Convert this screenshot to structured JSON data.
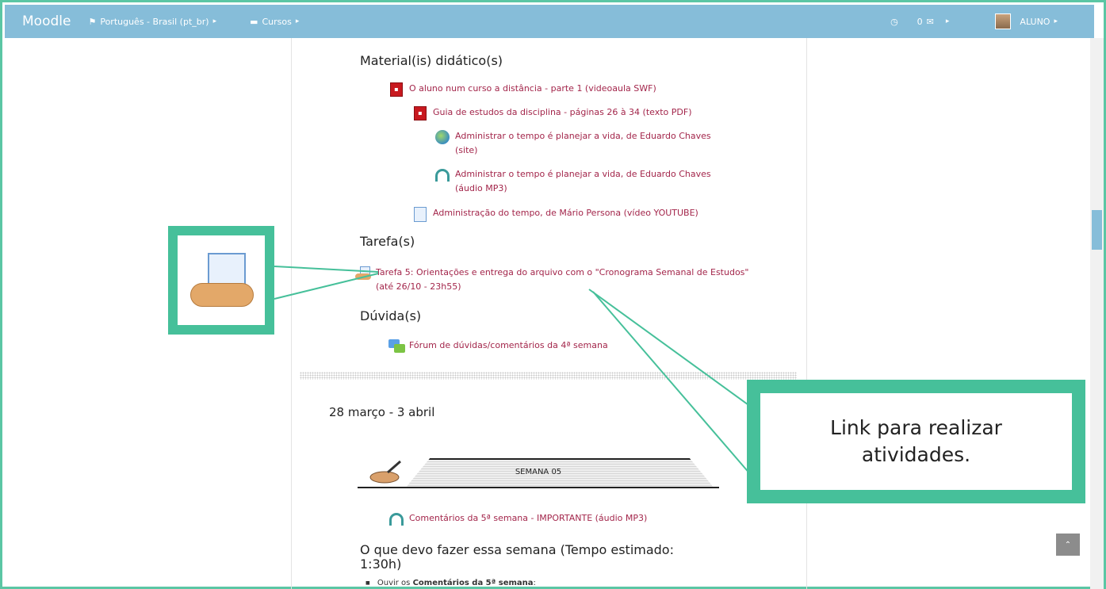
{
  "navbar": {
    "brand": "Moodle",
    "language": "Português - Brasil (pt_br)",
    "courses": "Cursos",
    "messages_count": "0",
    "user": "ALUNO"
  },
  "section_current": {
    "materials_heading": "Material(is) didático(s)",
    "materials": [
      {
        "label": "O aluno num curso a distância - parte 1 (videoaula SWF)",
        "icon": "pdf-icon"
      },
      {
        "label": "Guia de estudos da disciplina - páginas 26 à 34 (texto PDF)",
        "icon": "pdf-icon"
      },
      {
        "label": "Administrar o tempo é planejar a vida, de Eduardo Chaves (site)",
        "icon": "globe-icon"
      },
      {
        "label": "Administrar o tempo é planejar a vida, de Eduardo Chaves (áudio MP3)",
        "icon": "audio-icon"
      },
      {
        "label": "Administração do tempo, de Mário Persona (vídeo YOUTUBE)",
        "icon": "page-icon"
      }
    ],
    "tasks_heading": "Tarefa(s)",
    "task": {
      "label": "Tarefa 5: Orientações e entrega do arquivo com o \"Cronograma Semanal de Estudos\" (até 26/10 - 23h55)",
      "icon": "assignment-icon"
    },
    "doubts_heading": "Dúvida(s)",
    "forum": {
      "label": "Fórum de dúvidas/comentários da 4ª semana",
      "icon": "forum-icon"
    }
  },
  "section_next": {
    "date_heading": "28 março - 3 abril",
    "banner": "SEMANA 05",
    "comments": {
      "label": "Comentários da 5ª semana - IMPORTANTE (áudio MP3)",
      "icon": "audio-icon"
    },
    "todo_heading": "O que devo fazer essa semana (Tempo estimado: 1:30h)",
    "bullet_prefix": "Ouvir os ",
    "bullet_bold": "Comentários da 5ª semana",
    "bullet_suffix": ":"
  },
  "annotation": {
    "callout_text": "Link para realizar atividades."
  },
  "colors": {
    "navbar": "#86bdd9",
    "link": "#a3264b",
    "annotation": "#46c09a"
  }
}
